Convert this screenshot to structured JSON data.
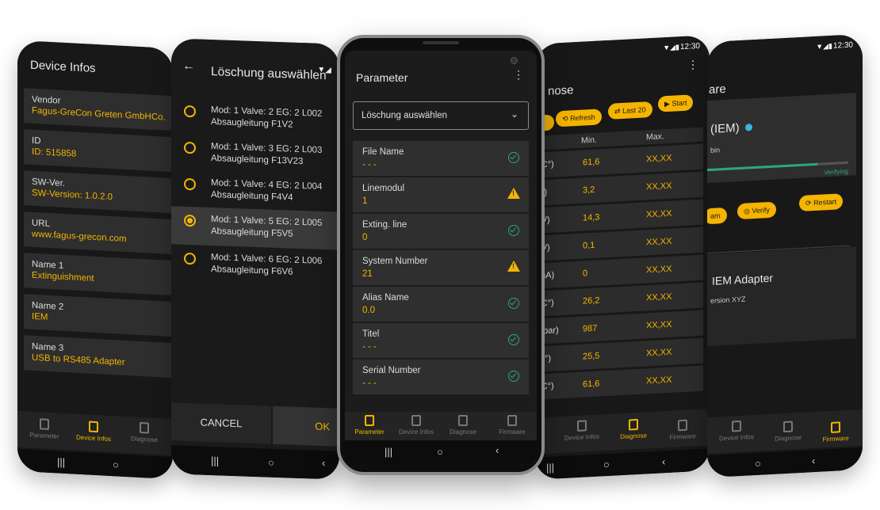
{
  "status_time": "12:30",
  "device_infos": {
    "title": "Device Infos",
    "fields": [
      {
        "label": "Vendor",
        "value": "Fagus-GreCon Greten GmbHCo."
      },
      {
        "label": "ID",
        "value": "ID: 515858"
      },
      {
        "label": "SW-Ver.",
        "value": "SW-Version: 1.0.2.0"
      },
      {
        "label": "URL",
        "value": "www.fagus-grecon.com"
      },
      {
        "label": "Name 1",
        "value": "Extinguishment"
      },
      {
        "label": "Name 2",
        "value": "IEM"
      },
      {
        "label": "Name 3",
        "value": "USB to RS485 Adapter"
      }
    ],
    "nav": [
      "Parameter",
      "Device Infos",
      "Diagnose"
    ]
  },
  "dialog": {
    "title": "Löschung auswählen",
    "options": [
      {
        "line1": "Mod: 1 Valve: 2 EG: 2 L002",
        "line2": "Absaugleitung F1V2"
      },
      {
        "line1": "Mod: 1 Valve: 3 EG: 2 L003",
        "line2": "Absaugleitung F13V23"
      },
      {
        "line1": "Mod: 1 Valve: 4 EG: 2 L004",
        "line2": "Absaugleitung F4V4"
      },
      {
        "line1": "Mod: 1 Valve: 5 EG: 2 L005",
        "line2": "Absaugleitung F5V5"
      },
      {
        "line1": "Mod: 1 Valve: 6 EG: 2 L006",
        "line2": "Absaugleitung F6V6"
      }
    ],
    "cancel": "CANCEL",
    "ok": "OK"
  },
  "parameter": {
    "title": "Parameter",
    "dropdown": "Löschung auswählen",
    "rows": [
      {
        "label": "File Name",
        "value": "- - -",
        "status": "ok"
      },
      {
        "label": "Linemodul",
        "value": "1",
        "status": "warn"
      },
      {
        "label": "Exting. line",
        "value": "0",
        "status": "ok"
      },
      {
        "label": "System Number",
        "value": "21",
        "status": "warn"
      },
      {
        "label": "Alias Name",
        "value": "0.0",
        "status": "ok"
      },
      {
        "label": "Titel",
        "value": "- - -",
        "status": "ok"
      },
      {
        "label": "Serial Number",
        "value": "- - -",
        "status": "ok"
      }
    ],
    "nav": [
      "Parameter",
      "Device Infos",
      "Diagnose",
      "Firmware"
    ]
  },
  "diagnose": {
    "title_fragment": "nose",
    "buttons": [
      "Refresh",
      "Last 20",
      "Start"
    ],
    "col_min": "Min.",
    "col_max": "Max.",
    "rows": [
      {
        "unit": "(C°)",
        "min": "61,6",
        "max": "XX,XX"
      },
      {
        "unit": "V)",
        "min": "3,2",
        "max": "XX,XX"
      },
      {
        "unit": "(V)",
        "min": "14,3",
        "max": "XX,XX"
      },
      {
        "unit": "(V)",
        "min": "0,1",
        "max": "XX,XX"
      },
      {
        "unit": "mA)",
        "min": "0",
        "max": "XX,XX"
      },
      {
        "unit": "(C°)",
        "min": "26,2",
        "max": "XX,XX"
      },
      {
        "unit": "nbar)",
        "min": "987",
        "max": "XX,XX"
      },
      {
        "unit": "C°)",
        "min": "25,5",
        "max": "XX,XX"
      },
      {
        "unit": "(C°)",
        "min": "61,6",
        "max": "XX,XX"
      }
    ],
    "nav": [
      "Device Infos",
      "Diagnose",
      "Firmware"
    ]
  },
  "firmware": {
    "title_fragment": "are",
    "device": "(IEM)",
    "sub": "bin",
    "progress_label": "Verifying",
    "progress": 0.78,
    "buttons": [
      "am",
      "Verify",
      "Restart"
    ],
    "adapter": "IEM Adapter",
    "version": "ersion XYZ",
    "nav": [
      "Device Infos",
      "Diagnose",
      "Firmware"
    ]
  }
}
